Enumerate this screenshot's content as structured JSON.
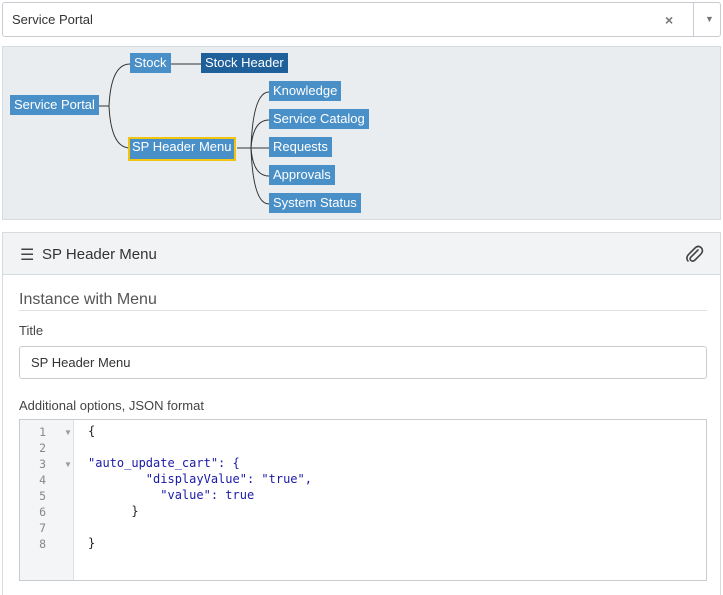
{
  "portal_select": {
    "value": "Service Portal",
    "clear_symbol": "×",
    "caret_symbol": "▼"
  },
  "tree": {
    "nodes": {
      "root": "Service Portal",
      "stock": "Stock",
      "stock_header": "Stock Header",
      "sp_header_menu": "SP Header Menu",
      "knowledge": "Knowledge",
      "service_catalog": "Service Catalog",
      "requests": "Requests",
      "approvals": "Approvals",
      "system_status": "System Status"
    },
    "selected": "SP Header Menu",
    "colors": {
      "node": "#4a90c8",
      "node_dark": "#1f5f9a",
      "selected_border": "#f1c40f"
    }
  },
  "panel": {
    "menu_icon": "hamburger-menu-icon",
    "menu_symbol": "☰",
    "title": "SP Header Menu",
    "attach_icon": "paperclip-icon"
  },
  "form": {
    "section_title": "Instance with Menu",
    "title_label": "Title",
    "title_value": "SP Header Menu",
    "options_label": "Additional options, JSON format"
  },
  "editor": {
    "line_numbers": [
      "1",
      "2",
      "3",
      "4",
      "5",
      "6",
      "7",
      "8"
    ],
    "fold_markers": [
      "▼",
      "",
      "▼",
      "",
      "",
      "",
      "",
      ""
    ],
    "lines": [
      "{",
      "",
      "\"auto_update_cart\": {",
      "        \"displayValue\": \"true\",",
      "          \"value\": true",
      "      }",
      "",
      "}"
    ]
  }
}
